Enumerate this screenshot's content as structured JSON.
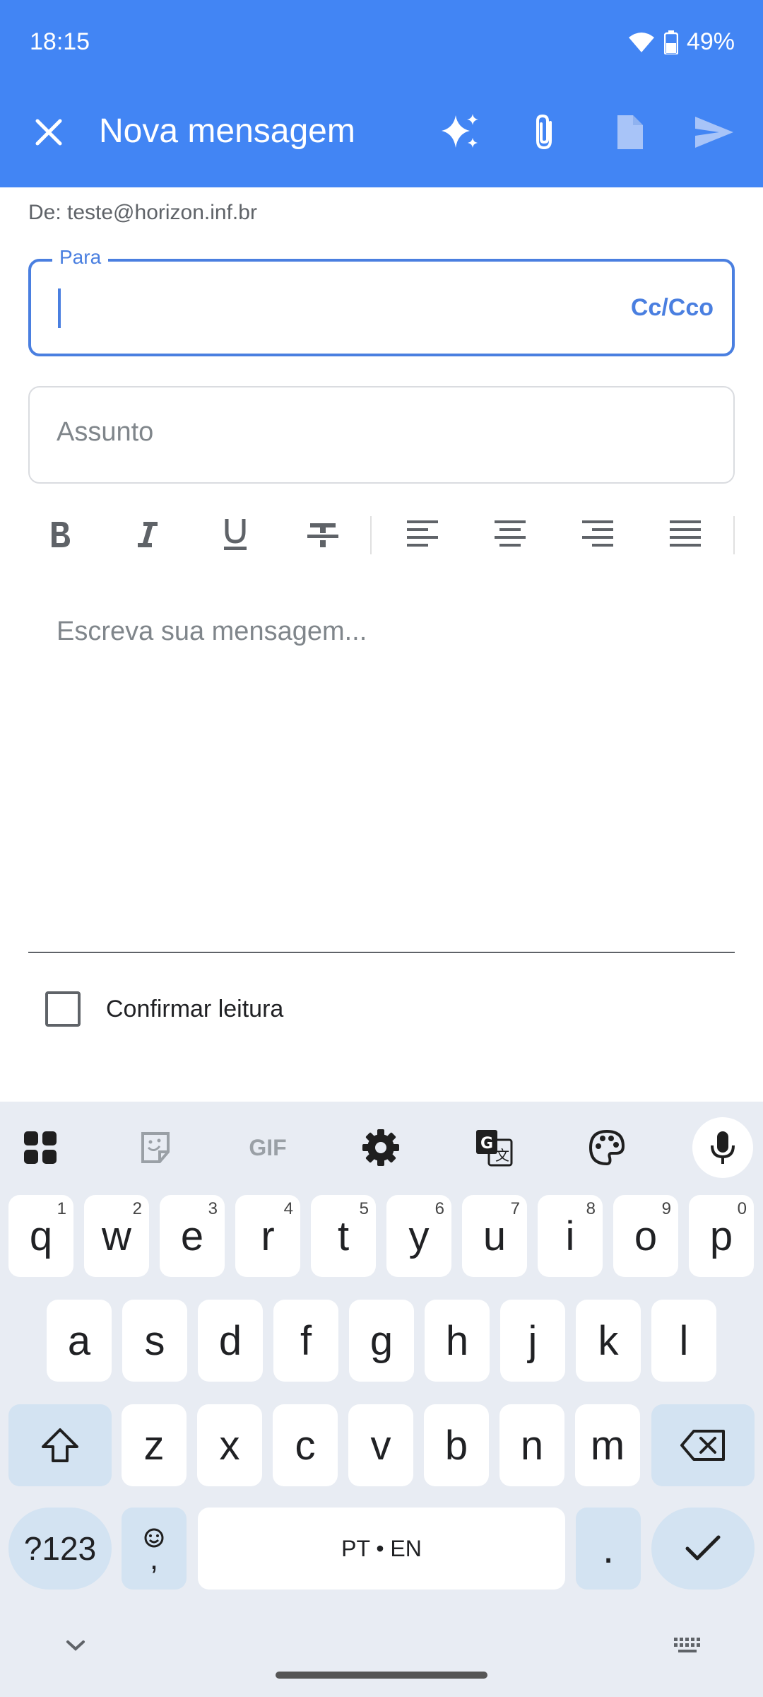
{
  "status_bar": {
    "time": "18:15",
    "battery": "49%"
  },
  "app_bar": {
    "title": "Nova mensagem",
    "icons": [
      "close-icon",
      "sparkle-icon",
      "attach-icon",
      "document-icon",
      "send-icon"
    ]
  },
  "compose": {
    "from": "De: teste@horizon.inf.br",
    "to_label": "Para",
    "cc_bcc": "Cc/Cco",
    "subject_placeholder": "Assunto",
    "body_placeholder": "Escreva sua mensagem...",
    "read_receipt_label": "Confirmar leitura"
  },
  "keyboard": {
    "toolbar_gif": "GIF",
    "row1": [
      {
        "k": "q",
        "h": "1"
      },
      {
        "k": "w",
        "h": "2"
      },
      {
        "k": "e",
        "h": "3"
      },
      {
        "k": "r",
        "h": "4"
      },
      {
        "k": "t",
        "h": "5"
      },
      {
        "k": "y",
        "h": "6"
      },
      {
        "k": "u",
        "h": "7"
      },
      {
        "k": "i",
        "h": "8"
      },
      {
        "k": "o",
        "h": "9"
      },
      {
        "k": "p",
        "h": "0"
      }
    ],
    "row2": [
      "a",
      "s",
      "d",
      "f",
      "g",
      "h",
      "j",
      "k",
      "l"
    ],
    "row3": [
      "z",
      "x",
      "c",
      "v",
      "b",
      "n",
      "m"
    ],
    "symbols_key": "?123",
    "comma_key": ",",
    "space_label": "PT • EN",
    "period_key": "."
  },
  "colors": {
    "accent": "#4285f4",
    "field_accent": "#4a7fe0",
    "keyboard_bg": "#e8ecf3",
    "func_key": "#d3e3f2"
  }
}
